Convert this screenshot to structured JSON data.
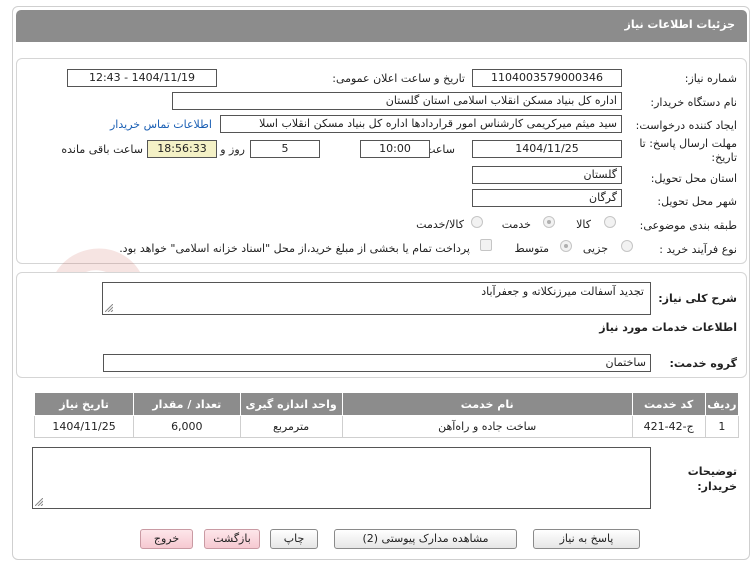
{
  "header": {
    "title": "جزئیات اطلاعات نیاز"
  },
  "form": {
    "need_number_label": "شماره نیاز:",
    "need_number": "1104003579000346",
    "announce_label": "تاریخ و ساعت اعلان عمومی:",
    "announce_value": "1404/11/19 - 12:43",
    "buyer_org_label": "نام دستگاه خریدار:",
    "buyer_org": "اداره کل بنیاد مسکن انقلاب اسلامی استان گلستان",
    "requester_label": "ایجاد کننده درخواست:",
    "requester": "سید میثم میرکریمی کارشناس امور قراردادها اداره کل بنیاد مسکن انقلاب اسلا",
    "contact_link": "اطلاعات تماس خریدار",
    "deadline_label_1": "مهلت ارسال پاسخ: تا",
    "deadline_label_2": "تاریخ:",
    "deadline_date": "1404/11/25",
    "time_label": "ساعت",
    "deadline_time": "10:00",
    "days_value": "5",
    "days_label": "روز و",
    "remaining_time": "18:56:33",
    "remaining_label": "ساعت باقی مانده",
    "province_label": "استان محل تحویل:",
    "province": "گلستان",
    "city_label": "شهر محل تحویل:",
    "city": "گرگان",
    "category_label": "طبقه بندی موضوعی:",
    "category_options": [
      "کالا",
      "خدمت",
      "کالا/خدمت"
    ],
    "category_selected": "خدمت",
    "process_label": "نوع فرآیند خرید :",
    "process_options": [
      "جزیی",
      "متوسط"
    ],
    "process_selected": "متوسط",
    "payment_note": "پرداخت تمام یا بخشی از مبلغ خرید،از محل \"اسناد خزانه اسلامی\" خواهد بود."
  },
  "summary": {
    "label": "شرح کلی نیاز:",
    "value": "تجدید آسفالت میرزنکلاته و جعفرآباد"
  },
  "services": {
    "section_title": "اطلاعات خدمات مورد نیاز",
    "group_label": "گروه خدمت:",
    "group_value": "ساختمان",
    "columns": [
      "ردیف",
      "کد خدمت",
      "نام خدمت",
      "واحد اندازه گیری",
      "تعداد / مقدار",
      "تاریخ نیاز"
    ],
    "rows": [
      {
        "index": "1",
        "code": "ج-42-421",
        "name": "ساخت جاده و راه‌آهن",
        "unit": "مترمربع",
        "quantity": "6,000",
        "date": "1404/11/25"
      }
    ]
  },
  "buyer_notes": {
    "label_1": "توضیحات",
    "label_2": "خریدار:",
    "value": ""
  },
  "buttons": {
    "reply": "پاسخ به نیاز",
    "view_docs": "مشاهده مدارک پیوستی (2)",
    "print": "چاپ",
    "back": "بازگشت",
    "exit": "خروج"
  },
  "colors": {
    "header_gray": "#8c8c8c",
    "link_blue": "#1a5fb4",
    "remaining_bg": "#f4f1c6",
    "exit_pink": "#f6c9d1"
  }
}
